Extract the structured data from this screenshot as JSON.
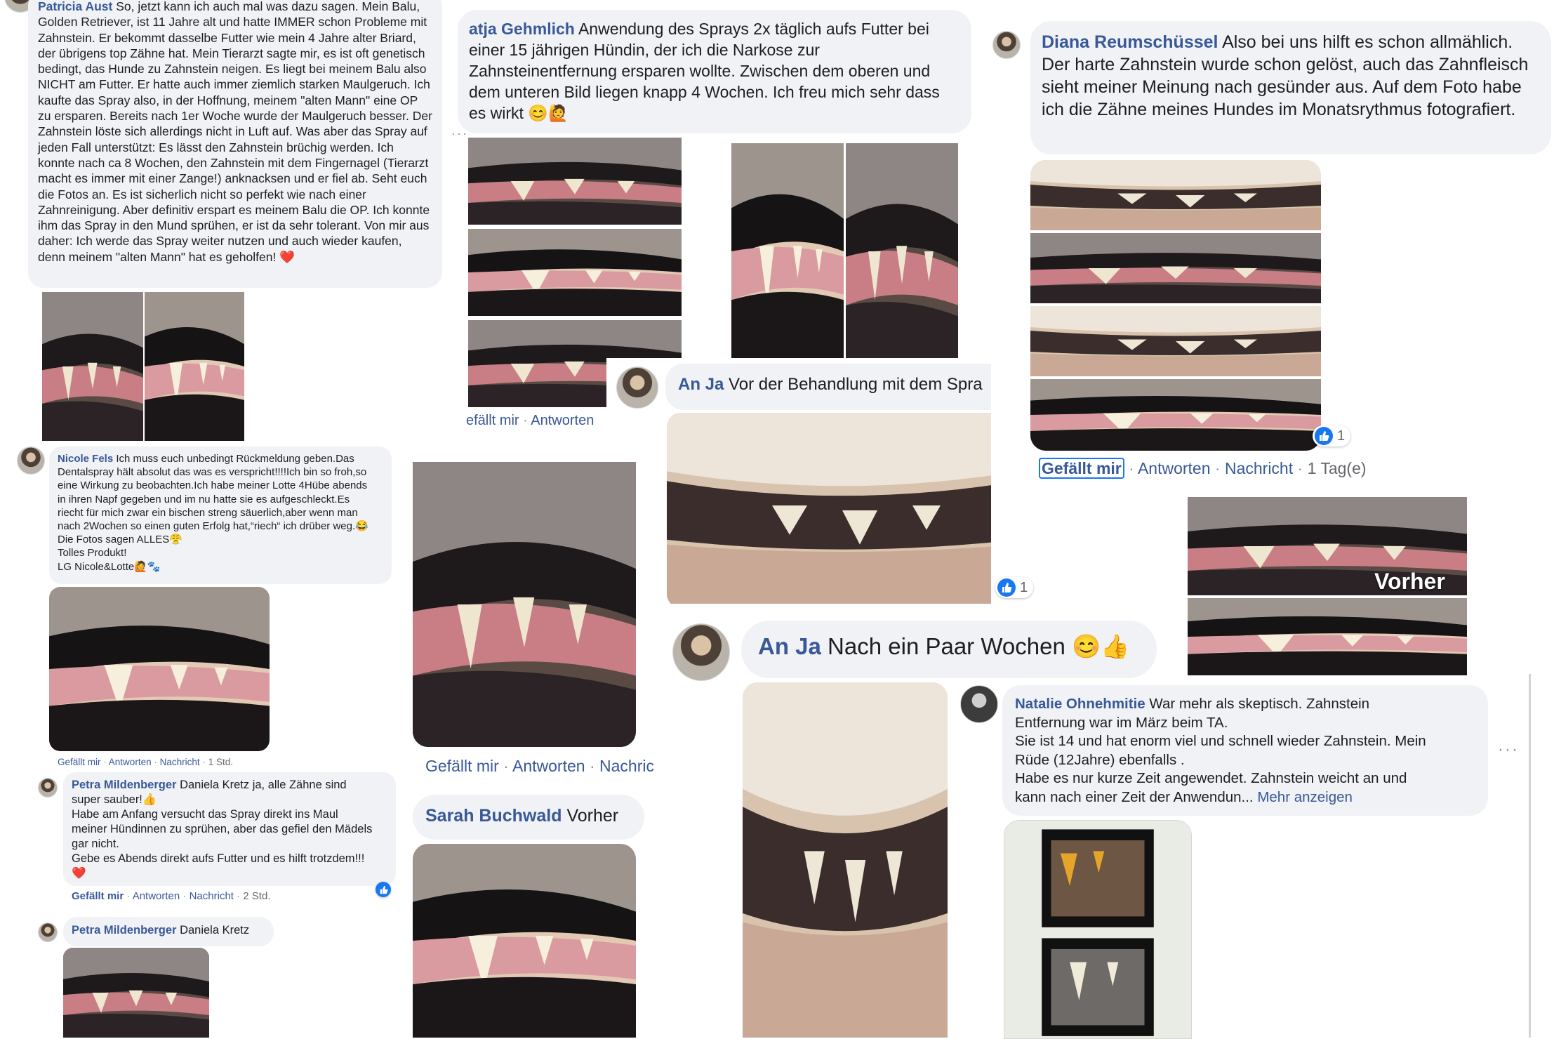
{
  "comments": {
    "patricia": {
      "name": "Patricia Aust",
      "text": "So, jetzt kann ich auch mal was dazu sagen. Mein Balu, Golden Retriever, ist 11 Jahre alt und hatte IMMER schon Probleme mit Zahnstein. Er bekommt dasselbe Futter wie mein 4 Jahre alter Briard, der übrigens top Zähne hat. Mein Tierarzt sagte mir, es ist oft genetisch bedingt, das Hunde zu Zahnstein neigen. Es liegt bei meinem Balu also NICHT am Futter. Er hatte auch immer ziemlich starken Maulgeruch. Ich kaufte das Spray also, in der Hoffnung, meinem \"alten Mann\" eine OP zu ersparen. Bereits nach 1er Woche wurde der Maulgeruch besser. Der Zahnstein löste sich allerdings nicht in Luft auf. Was aber das Spray auf jeden Fall unterstützt: Es lässt den Zahnstein brüchig werden. Ich konnte nach ca 8 Wochen, den Zahnstein mit dem Fingernagel (Tierarzt macht es immer mit einer Zange!) anknacksen und er fiel ab. Seht euch die Fotos an. Es ist sicherlich nicht so perfekt wie nach einer Zahnreinigung. Aber definitiv erspart es meinem Balu die OP. Ich konnte ihm das Spray in den Mund sprühen, er ist da sehr tolerant. Von mir aus daher: Ich werde das Spray weiter nutzen und auch wieder kaufen, denn meinem \"alten Mann\" hat es geholfen!",
      "heart": "❤️"
    },
    "katja": {
      "name": "atja Gehmlich",
      "text": "Anwendung des Sprays 2x täglich aufs Futter bei einer 15 jährigen Hündin, der ich die Narkose zur Zahnsteinentfernung ersparen wollte. Zwischen dem oberen und dem unteren Bild liegen knapp 4 Wochen. Ich freu mich sehr dass es wirkt",
      "emoji": "😊🙋"
    },
    "diana": {
      "name": "Diana Reumschüssel",
      "text": "Also bei uns hilft es schon allmählich. Der harte Zahnstein wurde schon gelöst, auch das Zahnfleisch sieht meiner Meinung nach gesünder aus. Auf dem Foto habe ich die Zähne meines Hundes im Monatsrythmus fotografiert.",
      "like_count": "1",
      "actions": {
        "like": "Gefällt mir",
        "reply": "Antworten",
        "message": "Nachricht",
        "time": "1 Tag(e)"
      }
    },
    "anja1": {
      "name": "An Ja",
      "text": "Vor der Behandlung mit dem Spra",
      "like_count": "1"
    },
    "anja2": {
      "name": "An Ja",
      "text": "Nach ein Paar Wochen",
      "emoji": "😊👍"
    },
    "nicole": {
      "name": "Nicole Fels",
      "lines": [
        "Ich muss euch unbedingt Rückmeldung geben.Das",
        "Dentalspray hält absolut das was es verspricht!!!!Ich bin so froh,so",
        "eine Wirkung zu beobachten.Ich habe meiner Lotte 4Hübe abends",
        "in ihren Napf gegeben und im nu hatte sie es aufgeschleckt.Es",
        "riecht für mich zwar ein bischen streng säuerlich,aber wenn man",
        "nach 2Wochen so einen guten Erfolg hat,“riech“ ich drüber weg.😂",
        "Die Fotos sagen ALLES😤",
        "Tolles Produkt!",
        "LG Nicole&Lotte🙋🐾"
      ],
      "actions": {
        "like": "Gefällt mir",
        "reply": "Antworten",
        "message": "Nachricht",
        "time": "1 Std."
      }
    },
    "petra1": {
      "name": "Petra Mildenberger",
      "lines": [
        "Daniela Kretz ja, alle Zähne sind",
        "super sauber!👍",
        "Habe am Anfang versucht das Spray direkt ins Maul",
        "meiner Hündinnen zu sprühen, aber das gefiel den Mädels",
        "gar nicht.",
        "Gebe es Abends direkt aufs Futter und es hilft trotzdem!!!",
        "❤️"
      ],
      "actions": {
        "like": "Gefällt mir",
        "reply": "Antworten",
        "message": "Nachricht",
        "time": "2 Std."
      }
    },
    "petra2": {
      "name": "Petra Mildenberger",
      "text": "Daniela Kretz"
    },
    "sarah": {
      "name": "Sarah Buchwald",
      "text": "Vorher",
      "actions_above": {
        "like": "Gefällt mir",
        "reply": "Antworten",
        "message": "Nachric"
      }
    },
    "natalie": {
      "name": "Natalie Ohnehmitie",
      "lines": [
        "War mehr als skeptisch. Zahnstein",
        "Entfernung war im März beim TA.",
        "Sie ist 14 und hat enorm viel und schnell wieder Zahnstein. Mein",
        "Rüde (12Jahre) ebenfalls .",
        "Habe es nur kurze Zeit angewendet. Zahnstein weicht an und",
        "kann nach einer Zeit der Anwendun..."
      ],
      "more": "Mehr anzeigen"
    },
    "katja_actions": {
      "like": "efällt mir",
      "reply": "Antworten"
    }
  },
  "photo_labels": {
    "vorher": "Vorher"
  },
  "colors": {
    "name": "#385898",
    "bubble": "#f0f2f5",
    "like": "#1877f2",
    "text": "#1c1e21"
  }
}
